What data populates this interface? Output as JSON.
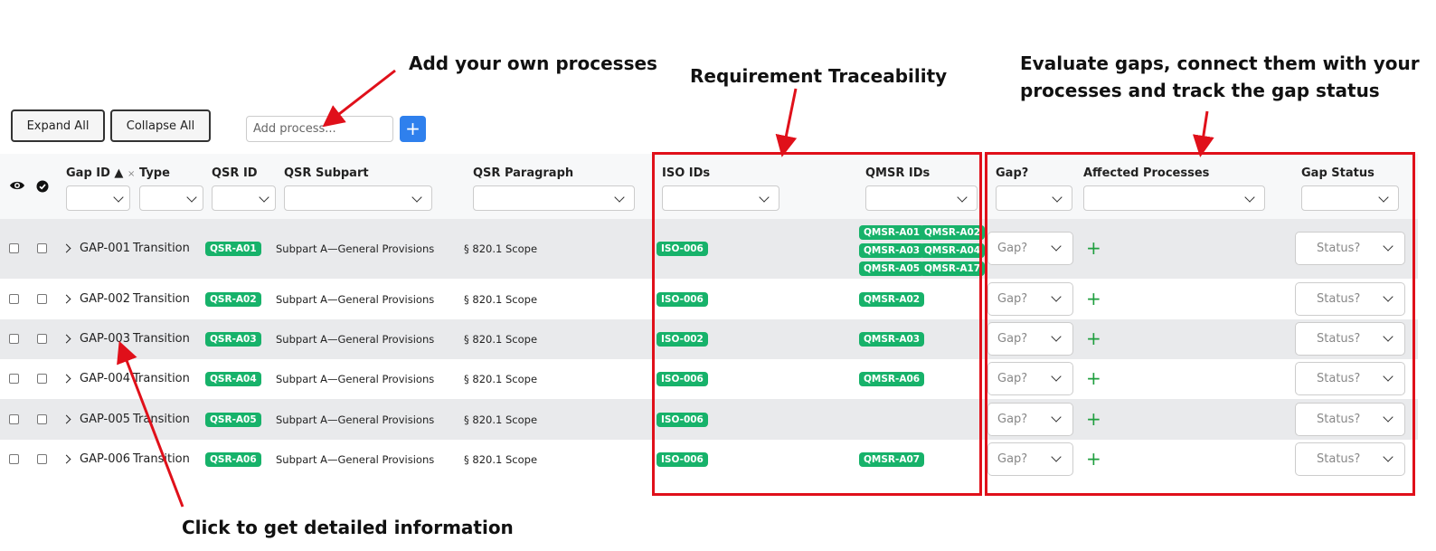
{
  "annotations": {
    "add_processes": "Add your own processes",
    "traceability": "Requirement Traceability",
    "evaluate_line1": "Evaluate gaps, connect them with your",
    "evaluate_line2": "processes and track the gap status",
    "click_details": "Click to get detailed information"
  },
  "toolbar": {
    "expand_all": "Expand All",
    "collapse_all": "Collapse All",
    "add_process_placeholder": "Add process...",
    "add_button": "+"
  },
  "columns": {
    "gap_id": "Gap ID ▲",
    "gap_id_clear": "×",
    "type": "Type",
    "qsr_id": "QSR ID",
    "qsr_subpart": "QSR Subpart",
    "qsr_paragraph": "QSR Paragraph",
    "iso_ids": "ISO IDs",
    "qmsr_ids": "QMSR IDs",
    "gap": "Gap?",
    "affected_processes": "Affected Processes",
    "gap_status": "Gap Status"
  },
  "placeholders": {
    "gap": "Gap?",
    "status": "Status?",
    "add_process_icon": "+"
  },
  "colors": {
    "badge": "#17b26a",
    "highlight": "#e0101a",
    "primary_button": "#2f80ed",
    "add_icon": "#1e9e3e"
  },
  "rows": [
    {
      "gap_id": "GAP-001",
      "type": "Transition",
      "qsr_id": "QSR-A01",
      "subpart": "Subpart A—General Provisions",
      "paragraph": "§ 820.1 Scope",
      "iso_ids": [
        "ISO-006"
      ],
      "qmsr_ids": [
        "QMSR-A01",
        "QMSR-A02",
        "QMSR-A03",
        "QMSR-A04",
        "QMSR-A05",
        "QMSR-A17"
      ]
    },
    {
      "gap_id": "GAP-002",
      "type": "Transition",
      "qsr_id": "QSR-A02",
      "subpart": "Subpart A—General Provisions",
      "paragraph": "§ 820.1 Scope",
      "iso_ids": [
        "ISO-006"
      ],
      "qmsr_ids": [
        "QMSR-A02"
      ]
    },
    {
      "gap_id": "GAP-003",
      "type": "Transition",
      "qsr_id": "QSR-A03",
      "subpart": "Subpart A—General Provisions",
      "paragraph": "§ 820.1 Scope",
      "iso_ids": [
        "ISO-002"
      ],
      "qmsr_ids": [
        "QMSR-A03"
      ]
    },
    {
      "gap_id": "GAP-004",
      "type": "Transition",
      "qsr_id": "QSR-A04",
      "subpart": "Subpart A—General Provisions",
      "paragraph": "§ 820.1 Scope",
      "iso_ids": [
        "ISO-006"
      ],
      "qmsr_ids": [
        "QMSR-A06"
      ]
    },
    {
      "gap_id": "GAP-005",
      "type": "Transition",
      "qsr_id": "QSR-A05",
      "subpart": "Subpart A—General Provisions",
      "paragraph": "§ 820.1 Scope",
      "iso_ids": [
        "ISO-006"
      ],
      "qmsr_ids": []
    },
    {
      "gap_id": "GAP-006",
      "type": "Transition",
      "qsr_id": "QSR-A06",
      "subpart": "Subpart A—General Provisions",
      "paragraph": "§ 820.1 Scope",
      "iso_ids": [
        "ISO-006"
      ],
      "qmsr_ids": [
        "QMSR-A07"
      ]
    }
  ]
}
